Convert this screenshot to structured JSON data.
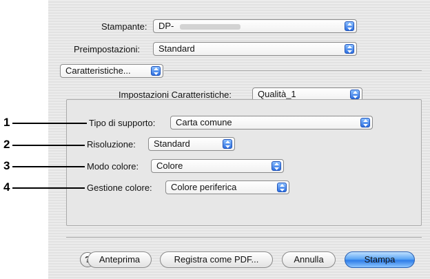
{
  "printer": {
    "label": "Stampante:",
    "value": "DP-"
  },
  "presets": {
    "label": "Preimpostazioni:",
    "value": "Standard"
  },
  "panel_selector": {
    "value": "Caratteristiche..."
  },
  "feature_set": {
    "label": "Impostazioni Caratteristiche:",
    "value": "Qualità_1"
  },
  "settings": [
    {
      "label": "Tipo di supporto:",
      "value": "Carta comune"
    },
    {
      "label": "Risoluzione:",
      "value": "Standard"
    },
    {
      "label": "Modo colore:",
      "value": "Colore"
    },
    {
      "label": "Gestione colore:",
      "value": "Colore periferica"
    }
  ],
  "callouts": [
    "1",
    "2",
    "3",
    "4"
  ],
  "buttons": {
    "help": "?",
    "preview": "Anteprima",
    "save_pdf": "Registra come PDF...",
    "cancel": "Annulla",
    "print": "Stampa"
  },
  "colors": {
    "accent": "#3d86ee"
  }
}
